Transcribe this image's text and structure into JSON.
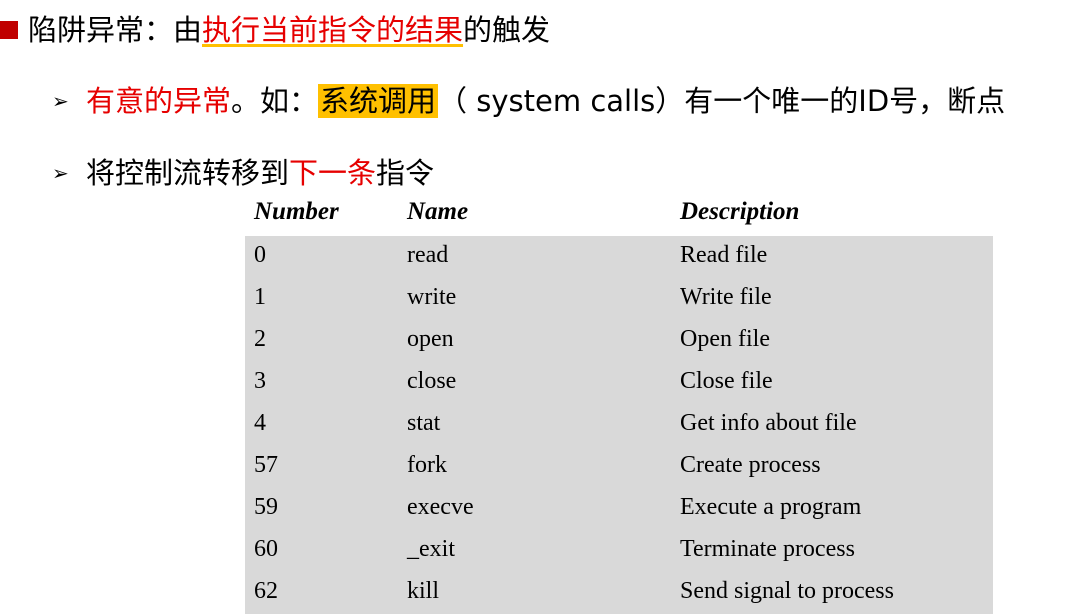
{
  "lines": {
    "l1": {
      "a": "陷阱异常：由",
      "b": "执行当前指令的结果",
      "c": "的触发"
    },
    "l2": {
      "a": "有意的异常",
      "b": "。如：",
      "c": "系统调用",
      "d": "（ system calls）有一个唯一的ID号，断点"
    },
    "l3": {
      "a": "将控制流转移到",
      "b": "下一条",
      "c": "指令"
    }
  },
  "table": {
    "headers": [
      "Number",
      "Name",
      "Description"
    ],
    "rows": [
      [
        "0",
        "read",
        "Read file"
      ],
      [
        "1",
        "write",
        "Write file"
      ],
      [
        "2",
        "open",
        "Open file"
      ],
      [
        "3",
        "close",
        "Close file"
      ],
      [
        "4",
        "stat",
        "Get info about file"
      ],
      [
        "57",
        "fork",
        "Create process"
      ],
      [
        "59",
        "execve",
        "Execute a program"
      ],
      [
        "60",
        "_exit",
        "Terminate process"
      ],
      [
        "62",
        "kill",
        "Send signal to process"
      ]
    ]
  }
}
